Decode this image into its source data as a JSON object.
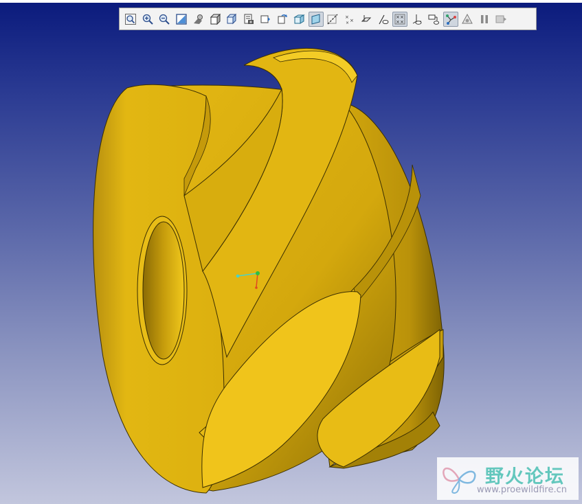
{
  "colors": {
    "background_top": "#0a1a7c",
    "background_bottom": "#c2c6dd",
    "model_face": "#f0c418",
    "model_side": "#d8ad0e",
    "model_shadow": "#9a7a06",
    "toolbar_bg": "#f3f3f3"
  },
  "toolbar": {
    "buttons": [
      {
        "name": "zoom-fit-icon",
        "active": false
      },
      {
        "name": "zoom-in-icon",
        "active": false
      },
      {
        "name": "zoom-out-icon",
        "active": false
      },
      {
        "name": "zoom-window-icon",
        "active": false
      },
      {
        "name": "orient-icon",
        "active": false
      },
      {
        "name": "shaded-box-icon",
        "active": false
      },
      {
        "name": "display-style-icon",
        "active": false
      },
      {
        "name": "saved-views-icon",
        "active": false
      },
      {
        "name": "view-manager-icon",
        "active": false
      },
      {
        "name": "spin-center-icon",
        "active": false
      },
      {
        "name": "perspective-icon",
        "active": false
      },
      {
        "name": "datum-planes-icon",
        "active": true
      },
      {
        "name": "datum-axes-icon",
        "active": false
      },
      {
        "name": "datum-points-icon",
        "active": false
      },
      {
        "name": "csys-icon",
        "active": false
      },
      {
        "name": "plane-tags-icon",
        "active": false
      },
      {
        "name": "point-tags-icon",
        "active": true
      },
      {
        "name": "csys-tags-icon",
        "active": false
      },
      {
        "name": "annotations-icon",
        "active": false
      },
      {
        "name": "spin-center-display-icon",
        "active": true
      },
      {
        "name": "regenerate-icon",
        "active": false
      },
      {
        "name": "pause-icon",
        "active": false
      },
      {
        "name": "next-icon",
        "active": false
      }
    ]
  },
  "watermark": {
    "title": "野火论坛",
    "url": "www.proewildfire.cn"
  }
}
